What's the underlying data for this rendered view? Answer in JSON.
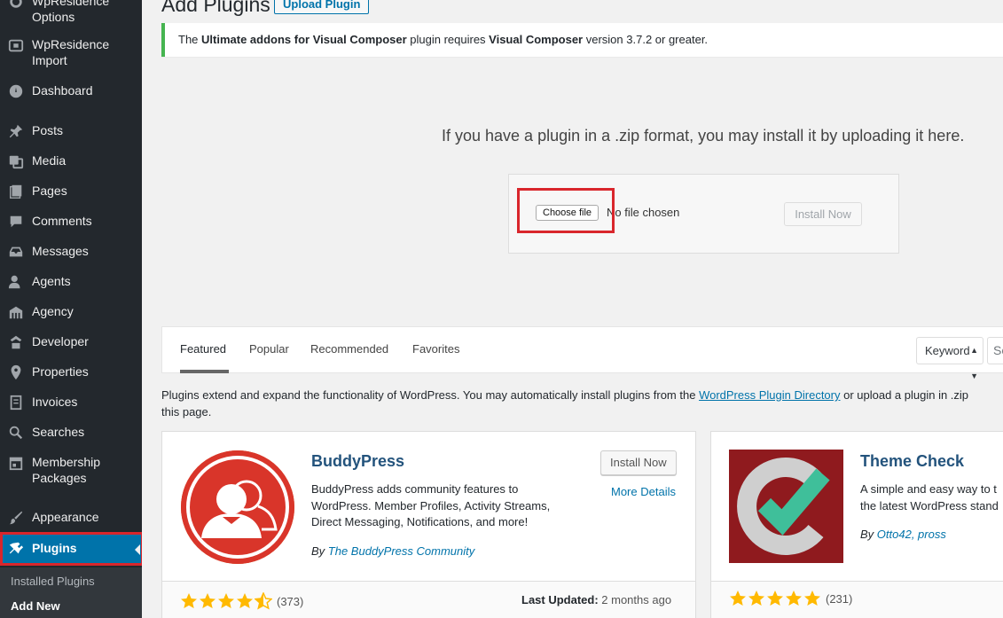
{
  "sidebar": {
    "items": [
      {
        "label": "WpResidence Options",
        "icon": "gear-icon"
      },
      {
        "label": "WpResidence Import",
        "icon": "import-icon"
      },
      {
        "label": "Dashboard",
        "icon": "dashboard-icon"
      },
      {
        "label": "Posts",
        "icon": "pin-icon"
      },
      {
        "label": "Media",
        "icon": "media-icon"
      },
      {
        "label": "Pages",
        "icon": "pages-icon"
      },
      {
        "label": "Comments",
        "icon": "comment-icon"
      },
      {
        "label": "Messages",
        "icon": "inbox-icon"
      },
      {
        "label": "Agents",
        "icon": "users-icon"
      },
      {
        "label": "Agency",
        "icon": "building-icon"
      },
      {
        "label": "Developer",
        "icon": "developer-icon"
      },
      {
        "label": "Properties",
        "icon": "location-icon"
      },
      {
        "label": "Invoices",
        "icon": "invoice-icon"
      },
      {
        "label": "Searches",
        "icon": "search-icon"
      },
      {
        "label": "Membership Packages",
        "icon": "calendar-icon"
      },
      {
        "label": "Appearance",
        "icon": "brush-icon"
      },
      {
        "label": "Plugins",
        "icon": "plugin-icon"
      }
    ],
    "submenu": [
      "Installed Plugins",
      "Add New"
    ]
  },
  "header": {
    "title": "Add Plugins",
    "upload_button": "Upload Plugin"
  },
  "notice": {
    "prefix": "The ",
    "plugin": "Ultimate addons for Visual Composer",
    "middle": " plugin requires ",
    "required": "Visual Composer",
    "suffix": " version 3.7.2 or greater."
  },
  "upload": {
    "instruction": "If you have a plugin in a .zip format, you may install it by uploading it here.",
    "choose_file": "Choose file",
    "no_file": "No file chosen",
    "install_button": "Install Now"
  },
  "filter": {
    "tabs": [
      "Featured",
      "Popular",
      "Recommended",
      "Favorites"
    ],
    "active_tab": "Featured",
    "search_type": "Keyword",
    "search_placeholder": "Se"
  },
  "intro": {
    "before_link": "Plugins extend and expand the functionality of WordPress. You may automatically install plugins from the ",
    "link": "WordPress Plugin Directory",
    "after_link": " or upload a plugin in .zip",
    "line2": "this page."
  },
  "plugins": [
    {
      "name": "BuddyPress",
      "description": "BuddyPress adds community features to WordPress. Member Profiles, Activity Streams, Direct Messaging, Notifications, and more!",
      "author_prefix": "By ",
      "author": "The BuddyPress Community",
      "install_label": "Install Now",
      "more_details": "More Details",
      "rating": 4.5,
      "rating_count": "(373)",
      "updated_label": "Last Updated:",
      "updated_value": " 2 months ago"
    },
    {
      "name": "Theme Check",
      "description": "A simple and easy way to t the latest WordPress stand",
      "author_prefix": "By ",
      "author": "Otto42, pross",
      "rating": 5,
      "rating_count": "(231)"
    }
  ],
  "colors": {
    "sidebar_bg": "#23282d",
    "active_blue": "#0073aa",
    "highlight_red": "#d9262c",
    "star": "#ffb900",
    "notice_green": "#46b450"
  }
}
